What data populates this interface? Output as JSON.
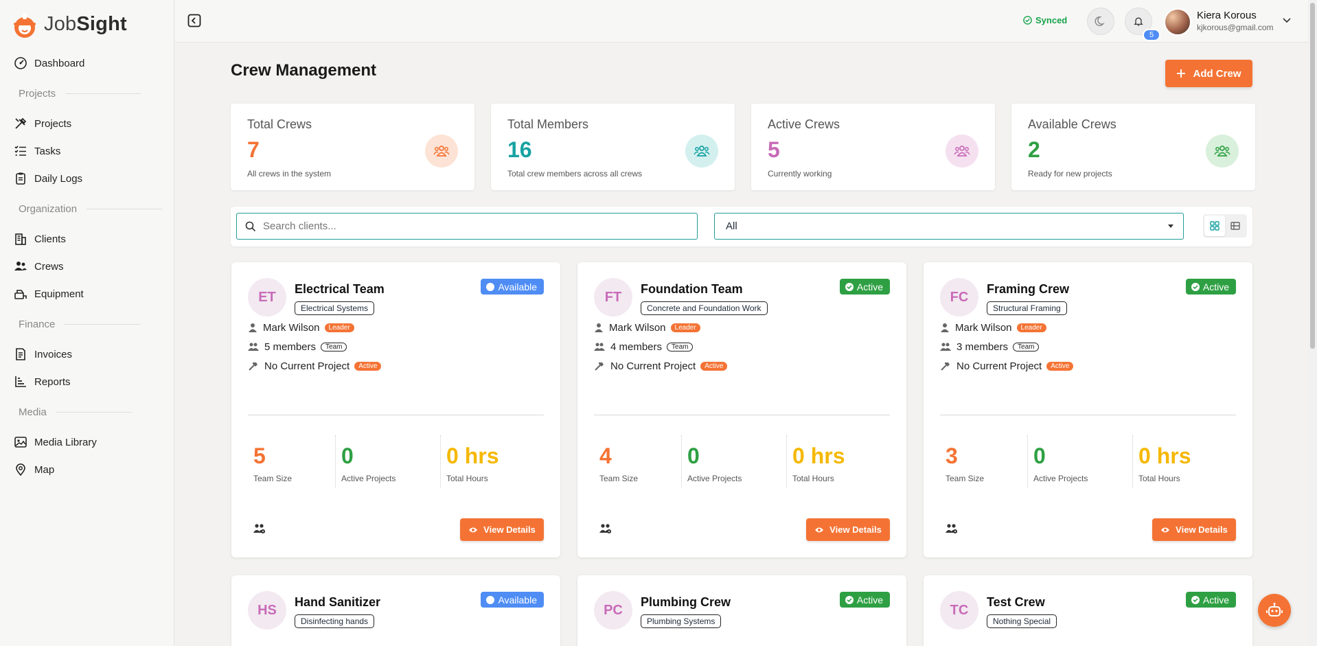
{
  "brand": {
    "name_light": "Job",
    "name_bold": "Sight",
    "accent": "#f47334"
  },
  "sidebar": {
    "items": [
      {
        "type": "item",
        "label": "Dashboard",
        "icon": "dashboard-icon"
      },
      {
        "type": "section",
        "label": "Projects"
      },
      {
        "type": "item",
        "label": "Projects",
        "icon": "tools-icon"
      },
      {
        "type": "item",
        "label": "Tasks",
        "icon": "tasks-icon"
      },
      {
        "type": "item",
        "label": "Daily Logs",
        "icon": "clipboard-icon"
      },
      {
        "type": "section",
        "label": "Organization"
      },
      {
        "type": "item",
        "label": "Clients",
        "icon": "building-icon"
      },
      {
        "type": "item",
        "label": "Crews",
        "icon": "users-icon"
      },
      {
        "type": "item",
        "label": "Equipment",
        "icon": "equipment-icon"
      },
      {
        "type": "section",
        "label": "Finance"
      },
      {
        "type": "item",
        "label": "Invoices",
        "icon": "invoice-icon"
      },
      {
        "type": "item",
        "label": "Reports",
        "icon": "chart-icon"
      },
      {
        "type": "section",
        "label": "Media"
      },
      {
        "type": "item",
        "label": "Media Library",
        "icon": "image-icon"
      },
      {
        "type": "item",
        "label": "Map",
        "icon": "map-pin-icon"
      }
    ]
  },
  "topbar": {
    "synced_label": "Synced",
    "notification_count": "5",
    "user_name": "Kiera Korous",
    "user_email": "kjkorous@gmail.com"
  },
  "page": {
    "title": "Crew Management",
    "add_button": "Add Crew"
  },
  "stats": [
    {
      "title": "Total Crews",
      "value": "7",
      "sub": "All crews in the system",
      "color": "#f47334",
      "bg": "#fde3d5"
    },
    {
      "title": "Total Members",
      "value": "16",
      "sub": "Total crew members across all crews",
      "color": "#17a2a2",
      "bg": "#d3f0ef"
    },
    {
      "title": "Active Crews",
      "value": "5",
      "sub": "Currently working",
      "color": "#c86bb8",
      "bg": "#f5e0f0"
    },
    {
      "title": "Available Crews",
      "value": "2",
      "sub": "Ready for new projects",
      "color": "#2ea043",
      "bg": "#d9f0dc"
    }
  ],
  "filters": {
    "search_placeholder": "Search clients...",
    "status_value": "All"
  },
  "crews": [
    {
      "initials": "ET",
      "name": "Electrical Team",
      "tag": "Electrical Systems",
      "status": "Available",
      "leader": "Mark Wilson",
      "leader_badge": "Leader",
      "members": "5 members",
      "team_badge": "Team",
      "project": "No Current Project",
      "project_badge": "Active",
      "team_size": "5",
      "team_size_label": "Team Size",
      "active_projects": "0",
      "active_projects_label": "Active Projects",
      "total_hours": "0 hrs",
      "total_hours_label": "Total Hours",
      "view_label": "View Details"
    },
    {
      "initials": "FT",
      "name": "Foundation Team",
      "tag": "Concrete and Foundation Work",
      "status": "Active",
      "leader": "Mark Wilson",
      "leader_badge": "Leader",
      "members": "4 members",
      "team_badge": "Team",
      "project": "No Current Project",
      "project_badge": "Active",
      "team_size": "4",
      "team_size_label": "Team Size",
      "active_projects": "0",
      "active_projects_label": "Active Projects",
      "total_hours": "0 hrs",
      "total_hours_label": "Total Hours",
      "view_label": "View Details"
    },
    {
      "initials": "FC",
      "name": "Framing Crew",
      "tag": "Structural Framing",
      "status": "Active",
      "leader": "Mark Wilson",
      "leader_badge": "Leader",
      "members": "3 members",
      "team_badge": "Team",
      "project": "No Current Project",
      "project_badge": "Active",
      "team_size": "3",
      "team_size_label": "Team Size",
      "active_projects": "0",
      "active_projects_label": "Active Projects",
      "total_hours": "0 hrs",
      "total_hours_label": "Total Hours",
      "view_label": "View Details"
    },
    {
      "initials": "HS",
      "name": "Hand Sanitizer",
      "tag": "Disinfecting hands",
      "status": "Available"
    },
    {
      "initials": "PC",
      "name": "Plumbing Crew",
      "tag": "Plumbing Systems",
      "status": "Active"
    },
    {
      "initials": "TC",
      "name": "Test Crew",
      "tag": "Nothing Special",
      "status": "Active"
    }
  ],
  "metric_colors": {
    "team_size": "#f47334",
    "active_projects": "#2ea043",
    "total_hours": "#f5b800"
  }
}
